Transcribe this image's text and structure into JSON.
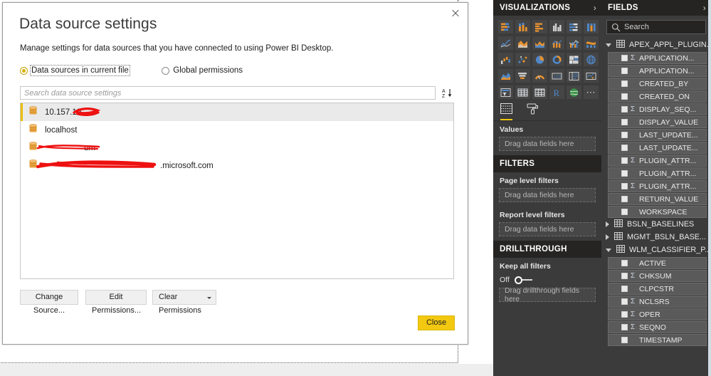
{
  "dialog": {
    "title": "Data source settings",
    "subtitle": "Manage settings for data sources that you have connected to using Power BI Desktop.",
    "close_icon": "close-icon",
    "radios": [
      {
        "label": "Data sources in current file",
        "selected": true,
        "focused": true
      },
      {
        "label": "Global permissions",
        "selected": false,
        "focused": false
      }
    ],
    "search": {
      "value": "",
      "placeholder": "Search data source settings"
    },
    "sort_icon": "sort-az-icon",
    "sources": [
      {
        "name": "10.157.19",
        "selected": true,
        "redacted": true
      },
      {
        "name": "localhost",
        "selected": false,
        "redacted": false
      },
      {
        "name": "um",
        "selected": false,
        "redacted": true
      },
      {
        "name": ".microsoft.com",
        "selected": false,
        "redacted": true
      }
    ],
    "buttons": {
      "change_source": "Change Source...",
      "edit_permissions": "Edit Permissions...",
      "clear_permissions": "Clear Permissions",
      "close": "Close"
    }
  },
  "visualizations": {
    "header": "VISUALIZATIONS",
    "expand_icon": "chevron-right-icon",
    "icons": [
      "stacked-bar-chart-icon",
      "stacked-column-chart-icon",
      "clustered-bar-chart-icon",
      "clustered-column-chart-icon",
      "100-stacked-bar-chart-icon",
      "100-stacked-column-chart-icon",
      "line-chart-icon",
      "area-chart-icon",
      "stacked-area-chart-icon",
      "line-stacked-column-chart-icon",
      "line-clustered-column-chart-icon",
      "ribbon-chart-icon",
      "waterfall-chart-icon",
      "scatter-chart-icon",
      "pie-chart-icon",
      "donut-chart-icon",
      "treemap-icon",
      "map-icon",
      "filled-map-icon",
      "funnel-icon",
      "gauge-icon",
      "card-icon",
      "multi-row-card-icon",
      "kpi-icon",
      "slicer-icon",
      "table-icon",
      "matrix-icon",
      "r-script-visual-icon",
      "arcgis-map-icon",
      "more-options-icon"
    ],
    "tabs": [
      {
        "icon": "fields-table-icon",
        "active": true
      },
      {
        "icon": "format-paint-roller-icon",
        "active": false
      }
    ],
    "values_label": "Values",
    "values_placeholder": "Drag data fields here",
    "filters_header": "FILTERS",
    "page_level_label": "Page level filters",
    "page_level_placeholder": "Drag data fields here",
    "report_level_label": "Report level filters",
    "report_level_placeholder": "Drag data fields here",
    "drillthrough_header": "DRILLTHROUGH",
    "keep_all_filters_label": "Keep all filters",
    "keep_all_filters_state": "Off",
    "drillthrough_placeholder": "Drag drillthrough fields here"
  },
  "fields": {
    "header": "FIELDS",
    "expand_icon": "chevron-right-icon",
    "search_placeholder": "Search",
    "search_icon": "search-icon",
    "tables": [
      {
        "name": "APEX_APPL_PLUGIN...",
        "expanded": true,
        "icon": "table-icon",
        "fields": [
          {
            "name": "APPLICATION...",
            "aggregate": true
          },
          {
            "name": "APPLICATION...",
            "aggregate": false
          },
          {
            "name": "CREATED_BY",
            "aggregate": false
          },
          {
            "name": "CREATED_ON",
            "aggregate": false
          },
          {
            "name": "DISPLAY_SEQ...",
            "aggregate": true
          },
          {
            "name": "DISPLAY_VALUE",
            "aggregate": false
          },
          {
            "name": "LAST_UPDATE...",
            "aggregate": false
          },
          {
            "name": "LAST_UPDATE...",
            "aggregate": false
          },
          {
            "name": "PLUGIN_ATTR...",
            "aggregate": true
          },
          {
            "name": "PLUGIN_ATTR...",
            "aggregate": false
          },
          {
            "name": "PLUGIN_ATTR...",
            "aggregate": true
          },
          {
            "name": "RETURN_VALUE",
            "aggregate": false
          },
          {
            "name": "WORKSPACE",
            "aggregate": false
          }
        ]
      },
      {
        "name": "BSLN_BASELINES",
        "expanded": false,
        "icon": "table-icon",
        "fields": []
      },
      {
        "name": "MGMT_BSLN_BASE...",
        "expanded": false,
        "icon": "table-icon",
        "fields": []
      },
      {
        "name": "WLM_CLASSIFIER_P...",
        "expanded": true,
        "icon": "table-icon",
        "fields": [
          {
            "name": "ACTIVE",
            "aggregate": false
          },
          {
            "name": "CHKSUM",
            "aggregate": true
          },
          {
            "name": "CLPCSTR",
            "aggregate": false
          },
          {
            "name": "NCLSRS",
            "aggregate": true
          },
          {
            "name": "OPER",
            "aggregate": true
          },
          {
            "name": "SEQNO",
            "aggregate": true
          },
          {
            "name": "TIMESTAMP",
            "aggregate": false
          }
        ]
      }
    ]
  },
  "colors": {
    "accent_yellow": "#f2c811",
    "panel_dark": "#3b3b3b",
    "panel_header_dark": "#252423",
    "redaction_red": "#e81818"
  }
}
